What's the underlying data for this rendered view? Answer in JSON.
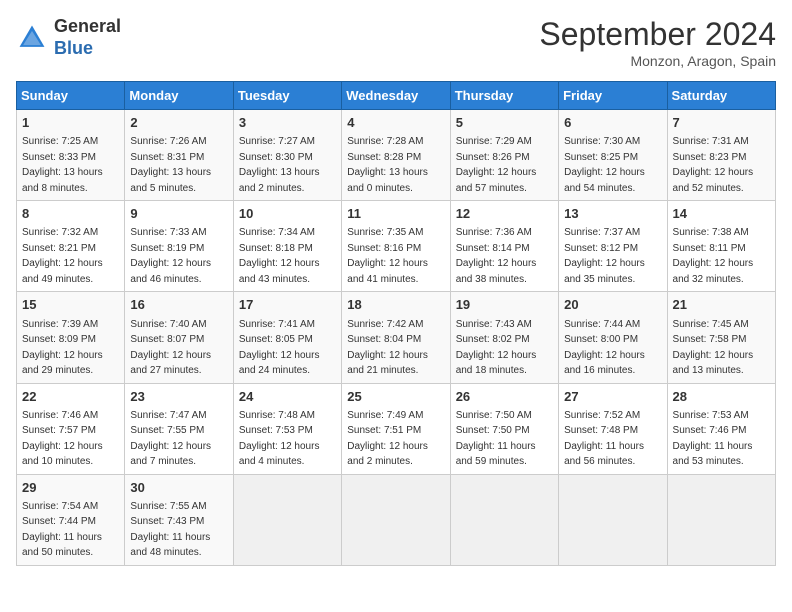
{
  "header": {
    "logo_line1": "General",
    "logo_line2": "Blue",
    "month": "September 2024",
    "location": "Monzon, Aragon, Spain"
  },
  "days_of_week": [
    "Sunday",
    "Monday",
    "Tuesday",
    "Wednesday",
    "Thursday",
    "Friday",
    "Saturday"
  ],
  "weeks": [
    [
      {
        "day": "1",
        "sunrise": "7:25 AM",
        "sunset": "8:33 PM",
        "daylight": "13 hours and 8 minutes."
      },
      {
        "day": "2",
        "sunrise": "7:26 AM",
        "sunset": "8:31 PM",
        "daylight": "13 hours and 5 minutes."
      },
      {
        "day": "3",
        "sunrise": "7:27 AM",
        "sunset": "8:30 PM",
        "daylight": "13 hours and 2 minutes."
      },
      {
        "day": "4",
        "sunrise": "7:28 AM",
        "sunset": "8:28 PM",
        "daylight": "13 hours and 0 minutes."
      },
      {
        "day": "5",
        "sunrise": "7:29 AM",
        "sunset": "8:26 PM",
        "daylight": "12 hours and 57 minutes."
      },
      {
        "day": "6",
        "sunrise": "7:30 AM",
        "sunset": "8:25 PM",
        "daylight": "12 hours and 54 minutes."
      },
      {
        "day": "7",
        "sunrise": "7:31 AM",
        "sunset": "8:23 PM",
        "daylight": "12 hours and 52 minutes."
      }
    ],
    [
      {
        "day": "8",
        "sunrise": "7:32 AM",
        "sunset": "8:21 PM",
        "daylight": "12 hours and 49 minutes."
      },
      {
        "day": "9",
        "sunrise": "7:33 AM",
        "sunset": "8:19 PM",
        "daylight": "12 hours and 46 minutes."
      },
      {
        "day": "10",
        "sunrise": "7:34 AM",
        "sunset": "8:18 PM",
        "daylight": "12 hours and 43 minutes."
      },
      {
        "day": "11",
        "sunrise": "7:35 AM",
        "sunset": "8:16 PM",
        "daylight": "12 hours and 41 minutes."
      },
      {
        "day": "12",
        "sunrise": "7:36 AM",
        "sunset": "8:14 PM",
        "daylight": "12 hours and 38 minutes."
      },
      {
        "day": "13",
        "sunrise": "7:37 AM",
        "sunset": "8:12 PM",
        "daylight": "12 hours and 35 minutes."
      },
      {
        "day": "14",
        "sunrise": "7:38 AM",
        "sunset": "8:11 PM",
        "daylight": "12 hours and 32 minutes."
      }
    ],
    [
      {
        "day": "15",
        "sunrise": "7:39 AM",
        "sunset": "8:09 PM",
        "daylight": "12 hours and 29 minutes."
      },
      {
        "day": "16",
        "sunrise": "7:40 AM",
        "sunset": "8:07 PM",
        "daylight": "12 hours and 27 minutes."
      },
      {
        "day": "17",
        "sunrise": "7:41 AM",
        "sunset": "8:05 PM",
        "daylight": "12 hours and 24 minutes."
      },
      {
        "day": "18",
        "sunrise": "7:42 AM",
        "sunset": "8:04 PM",
        "daylight": "12 hours and 21 minutes."
      },
      {
        "day": "19",
        "sunrise": "7:43 AM",
        "sunset": "8:02 PM",
        "daylight": "12 hours and 18 minutes."
      },
      {
        "day": "20",
        "sunrise": "7:44 AM",
        "sunset": "8:00 PM",
        "daylight": "12 hours and 16 minutes."
      },
      {
        "day": "21",
        "sunrise": "7:45 AM",
        "sunset": "7:58 PM",
        "daylight": "12 hours and 13 minutes."
      }
    ],
    [
      {
        "day": "22",
        "sunrise": "7:46 AM",
        "sunset": "7:57 PM",
        "daylight": "12 hours and 10 minutes."
      },
      {
        "day": "23",
        "sunrise": "7:47 AM",
        "sunset": "7:55 PM",
        "daylight": "12 hours and 7 minutes."
      },
      {
        "day": "24",
        "sunrise": "7:48 AM",
        "sunset": "7:53 PM",
        "daylight": "12 hours and 4 minutes."
      },
      {
        "day": "25",
        "sunrise": "7:49 AM",
        "sunset": "7:51 PM",
        "daylight": "12 hours and 2 minutes."
      },
      {
        "day": "26",
        "sunrise": "7:50 AM",
        "sunset": "7:50 PM",
        "daylight": "11 hours and 59 minutes."
      },
      {
        "day": "27",
        "sunrise": "7:52 AM",
        "sunset": "7:48 PM",
        "daylight": "11 hours and 56 minutes."
      },
      {
        "day": "28",
        "sunrise": "7:53 AM",
        "sunset": "7:46 PM",
        "daylight": "11 hours and 53 minutes."
      }
    ],
    [
      {
        "day": "29",
        "sunrise": "7:54 AM",
        "sunset": "7:44 PM",
        "daylight": "11 hours and 50 minutes."
      },
      {
        "day": "30",
        "sunrise": "7:55 AM",
        "sunset": "7:43 PM",
        "daylight": "11 hours and 48 minutes."
      },
      null,
      null,
      null,
      null,
      null
    ]
  ]
}
